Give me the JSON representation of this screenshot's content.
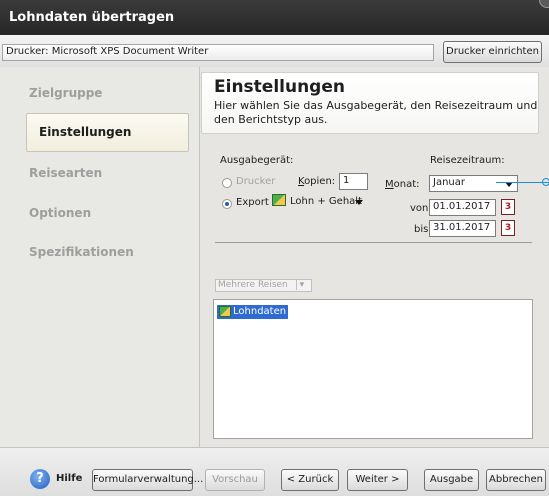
{
  "window": {
    "title": "Lohndaten übertragen"
  },
  "printer": {
    "label": "Drucker: Microsoft XPS Document Writer",
    "setup_button": "Drucker einrichten"
  },
  "sidebar": {
    "items": [
      {
        "label": "Zielgruppe",
        "active": false
      },
      {
        "label": "Einstellungen",
        "active": true
      },
      {
        "label": "Reisearten",
        "active": false
      },
      {
        "label": "Optionen",
        "active": false
      },
      {
        "label": "Spezifikationen",
        "active": false
      }
    ]
  },
  "header": {
    "title": "Einstellungen",
    "description": "Hier wählen Sie das Ausgabegerät, den Reisezeitraum und den Berichtstyp aus."
  },
  "output": {
    "label": "Ausgabegerät:",
    "printer_option": "Drucker",
    "copies_label": "Kopien:",
    "copies_value": "1",
    "export_option": "Export",
    "export_value": "Lohn + Gehalt",
    "selected": "Export"
  },
  "period": {
    "label": "Reisezeitraum:",
    "month_label": "Monat:",
    "month_value": "Januar",
    "from_label": "von:",
    "from_value": "01.01.2017",
    "to_label": "bis:",
    "to_value": "31.01.2017",
    "calendar_glyph": "3"
  },
  "multi_travel_button": "Mehrere Reisen",
  "report_list": {
    "items": [
      "Lohndaten"
    ]
  },
  "footer": {
    "help_label": "Hilfe",
    "forms_button": "Formularverwaltung...",
    "preview_button": "Vorschau",
    "back_button": "< Zurück",
    "next_button": "Weiter >",
    "output_button": "Ausgabe",
    "cancel_button": "Abbrechen"
  },
  "colors": {
    "titlebar": "#2f2f2f",
    "selection": "#2e6ad0",
    "sidebar_bg": "#e8e8e5",
    "panel_bg": "#e6e5e1",
    "callout": "#1b8fd6"
  }
}
